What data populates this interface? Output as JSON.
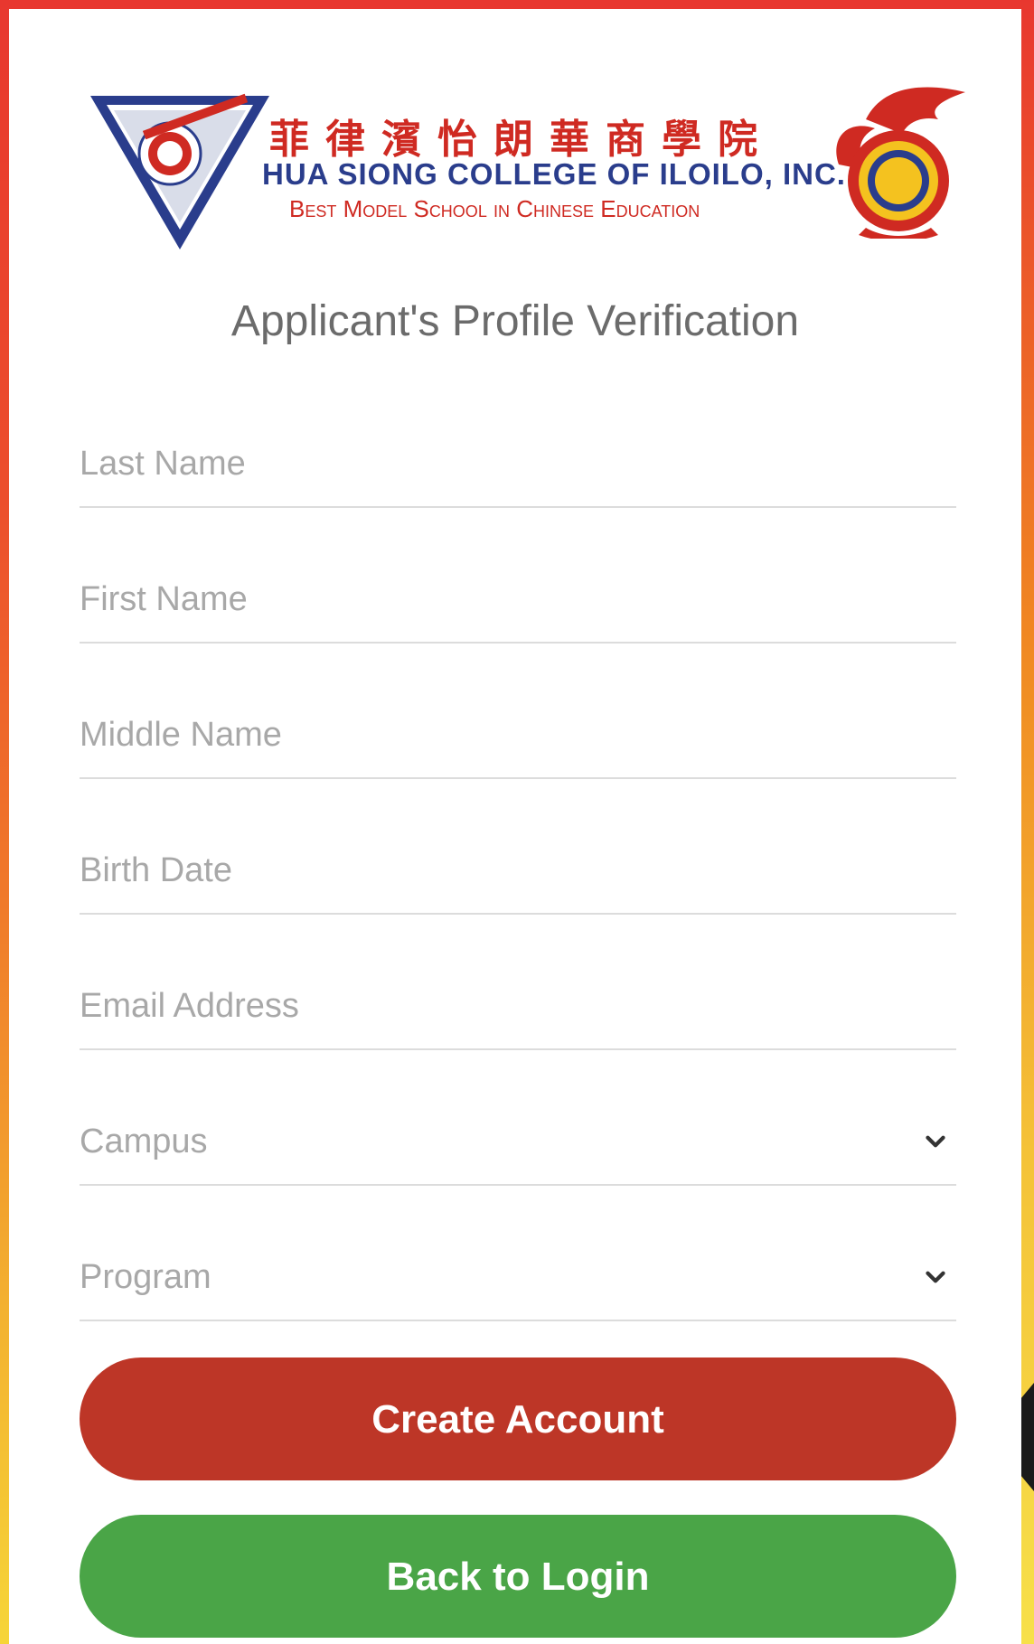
{
  "header": {
    "school_name_chinese": "菲律濱怡朗華商學院",
    "school_name_english": "HUA SIONG COLLEGE OF ILOILO, INC.",
    "school_tagline": "Best Model School in Chinese Education"
  },
  "page_title": "Applicant's Profile Verification",
  "form": {
    "last_name_placeholder": "Last Name",
    "first_name_placeholder": "First Name",
    "middle_name_placeholder": "Middle Name",
    "birth_date_placeholder": "Birth Date",
    "email_placeholder": "Email Address",
    "campus_placeholder": "Campus",
    "program_placeholder": "Program"
  },
  "buttons": {
    "create_account": "Create Account",
    "back_to_login": "Back to Login"
  },
  "colors": {
    "primary_red": "#bd3627",
    "success_green": "#4aa547",
    "border_gradient_top": "#e8372f",
    "border_gradient_bottom": "#f6d538"
  },
  "icons": {
    "campus_dropdown": "chevron-down-icon",
    "program_dropdown": "chevron-down-icon"
  }
}
